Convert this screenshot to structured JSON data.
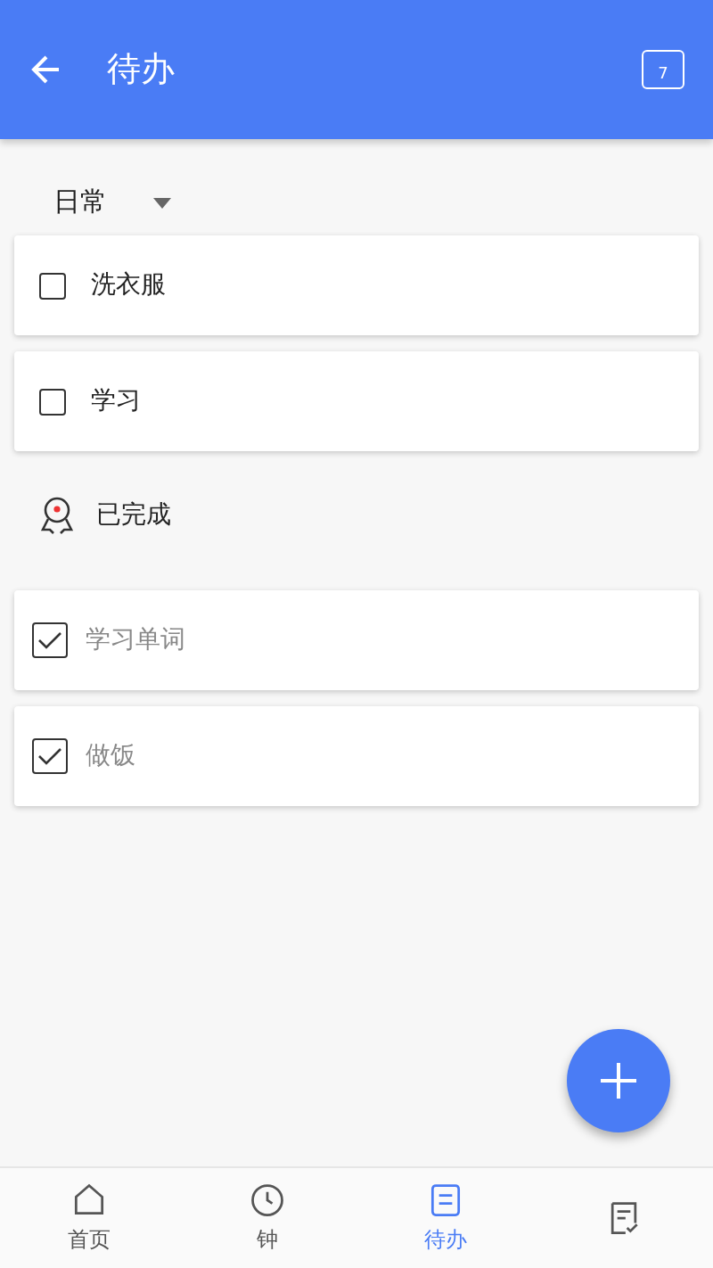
{
  "app_bar": {
    "title": "待办",
    "calendar_day": "7"
  },
  "category": {
    "label": "日常"
  },
  "todos": [
    {
      "text": "洗衣服",
      "checked": false
    },
    {
      "text": "学习",
      "checked": false
    }
  ],
  "done_header": {
    "label": "已完成"
  },
  "done": [
    {
      "text": "学习单词",
      "checked": true
    },
    {
      "text": "做饭",
      "checked": true
    }
  ],
  "bottom_nav": [
    {
      "kind": "home",
      "label": "首页",
      "selected": false
    },
    {
      "kind": "clock",
      "label": "钟",
      "selected": false
    },
    {
      "kind": "todo",
      "label": "待办",
      "selected": true
    },
    {
      "kind": "doc",
      "selected": false
    }
  ]
}
